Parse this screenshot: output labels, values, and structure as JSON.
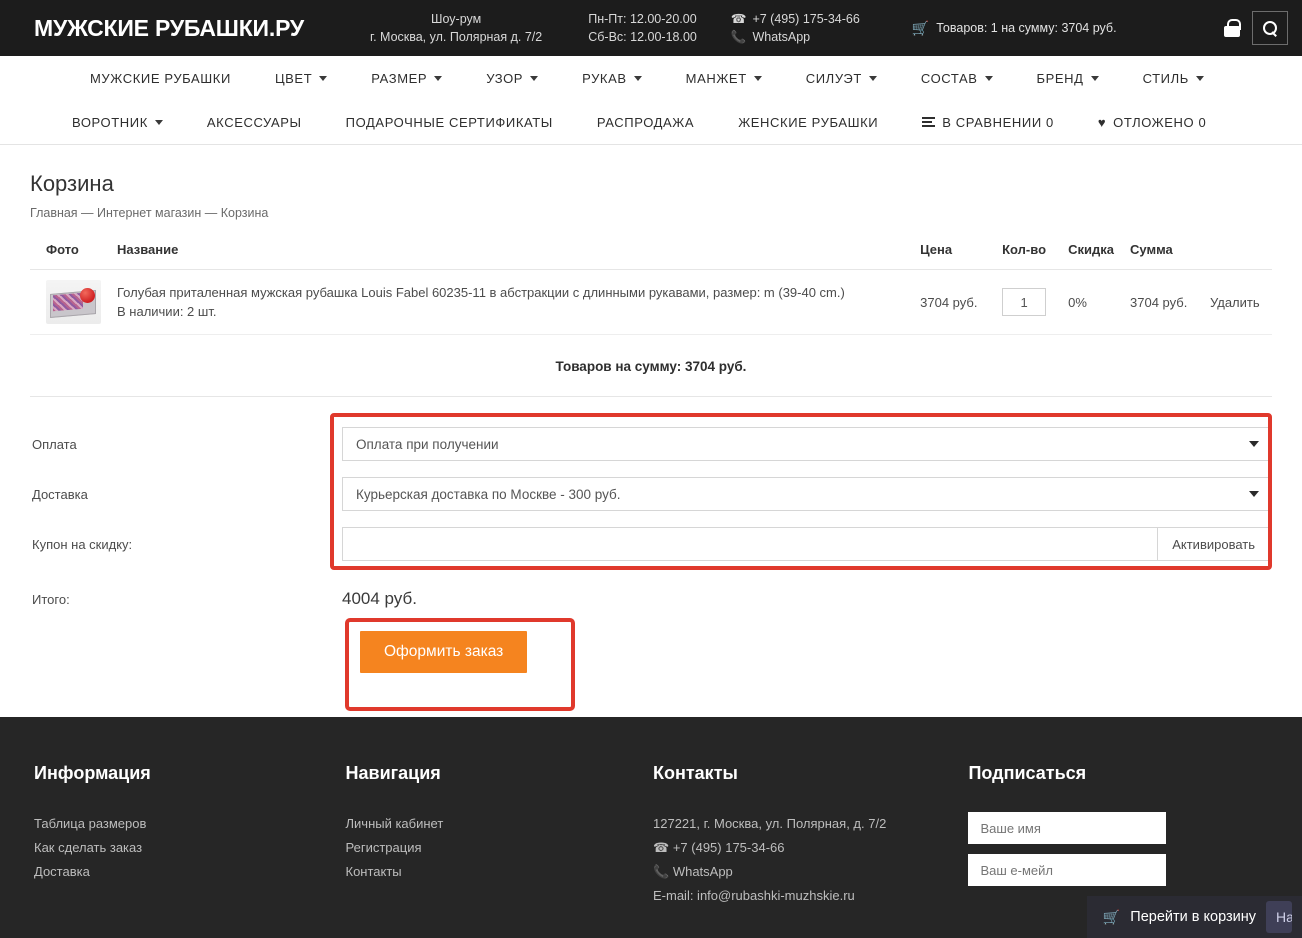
{
  "header": {
    "logo": "МУЖСКИЕ РУБАШКИ.РУ",
    "showroom_label": "Шоу-рум",
    "showroom_address": "г. Москва, ул. Полярная д. 7/2",
    "hours_weekday": "Пн-Пт: 12.00-20.00",
    "hours_weekend": "Сб-Вс: 12.00-18.00",
    "phone": "+7 (495) 175-34-66",
    "whatsapp": "WhatsApp",
    "cart_summary": "Товаров: 1 на сумму: 3704 руб.",
    "phone_icon": "telephone-icon",
    "whatsapp_icon": "whatsapp-icon",
    "cart_icon": "cart-icon",
    "lock_icon": "lock-icon",
    "search_icon": "search-icon"
  },
  "nav": {
    "row1": [
      {
        "label": "МУЖСКИЕ РУБАШКИ",
        "dropdown": false
      },
      {
        "label": "ЦВЕТ",
        "dropdown": true
      },
      {
        "label": "РАЗМЕР",
        "dropdown": true
      },
      {
        "label": "УЗОР",
        "dropdown": true
      },
      {
        "label": "РУКАВ",
        "dropdown": true
      },
      {
        "label": "МАНЖЕТ",
        "dropdown": true
      },
      {
        "label": "СИЛУЭТ",
        "dropdown": true
      },
      {
        "label": "СОСТАВ",
        "dropdown": true
      },
      {
        "label": "БРЕНД",
        "dropdown": true
      },
      {
        "label": "СТИЛЬ",
        "dropdown": true
      }
    ],
    "row2": [
      {
        "label": "ВОРОТНИК",
        "dropdown": true,
        "icon": ""
      },
      {
        "label": "АКСЕССУАРЫ",
        "dropdown": false,
        "icon": ""
      },
      {
        "label": "ПОДАРОЧНЫЕ СЕРТИФИКАТЫ",
        "dropdown": false,
        "icon": ""
      },
      {
        "label": "РАСПРОДАЖА",
        "dropdown": false,
        "icon": ""
      },
      {
        "label": "ЖЕНСКИЕ РУБАШКИ",
        "dropdown": false,
        "icon": ""
      },
      {
        "label": "В СРАВНЕНИИ 0",
        "dropdown": false,
        "icon": "compare-icon"
      },
      {
        "label": "ОТЛОЖЕНО 0",
        "dropdown": false,
        "icon": "heart-icon"
      }
    ]
  },
  "page": {
    "title": "Корзина",
    "breadcrumb": "Главная — Интернет магазин — Корзина"
  },
  "cart": {
    "columns": {
      "photo": "Фото",
      "name": "Название",
      "price": "Цена",
      "qty": "Кол-во",
      "discount": "Скидка",
      "sum": "Сумма",
      "delete": ""
    },
    "rows": [
      {
        "photo_alt": "product-thumbnail",
        "name": "Голубая приталенная мужская рубашка Louis Fabel 60235-11 в абстракции с длинными рукавами, размер: m (39-40 cm.)",
        "stock": "В наличии: 2 шт.",
        "price": "3704 руб.",
        "qty": "1",
        "discount": "0%",
        "sum": "3704 руб.",
        "delete_label": "Удалить"
      }
    ],
    "goods_total": "Товаров на сумму: 3704 руб."
  },
  "order_form": {
    "payment_label": "Оплата",
    "payment_value": "Оплата при получении",
    "delivery_label": "Доставка",
    "delivery_value": "Курьерская доставка по Москве - 300 руб.",
    "coupon_label": "Купон на скидку:",
    "coupon_value": "",
    "coupon_placeholder": "",
    "coupon_button": "Активировать",
    "itogo_label": "Итого:",
    "itogo_value": "4004 руб.",
    "submit_button": "Оформить заказ",
    "highlight_color": "#e0392c",
    "submit_color": "#f5841f"
  },
  "footer": {
    "col_information": {
      "heading": "Информация",
      "links": [
        "Таблица размеров",
        "Как сделать заказ",
        "Доставка"
      ]
    },
    "col_navigation": {
      "heading": "Навигация",
      "links": [
        "Личный кабинет",
        "Регистрация",
        "Контакты"
      ]
    },
    "col_contacts": {
      "heading": "Контакты",
      "address": "127221, г. Москва, ул. Полярная, д. 7/2",
      "phone": "+7 (495) 175-34-66",
      "whatsapp": "WhatsApp",
      "email": "E-mail: info@rubashki-muzhskie.ru"
    },
    "col_subscribe": {
      "heading": "Подписаться",
      "name_placeholder": "Ваше имя",
      "email_placeholder": "Ваш е-мейл"
    }
  },
  "float_cart": {
    "label": "Перейти в корзину",
    "icon": "cart-icon",
    "side_button": "На"
  }
}
